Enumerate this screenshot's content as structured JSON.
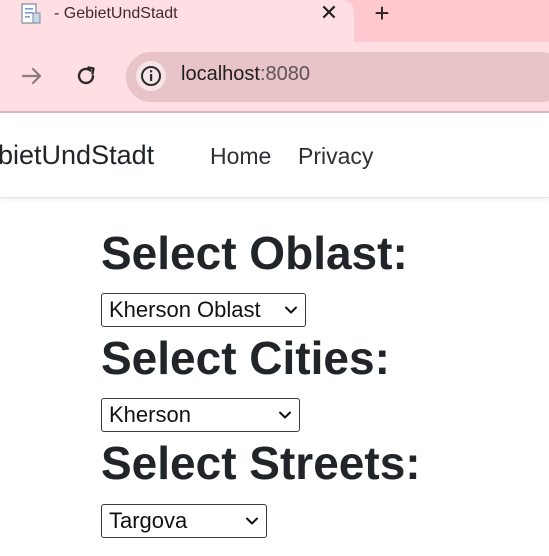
{
  "browser": {
    "tab_title": "- GebietUndStadt",
    "url_host": "localhost",
    "url_port": ":8080",
    "favicon": "page-icon",
    "close_symbol": "✕",
    "newtab_symbol": "+"
  },
  "navbar": {
    "brand": "bietUndStadt",
    "links": [
      "Home",
      "Privacy"
    ]
  },
  "form": {
    "oblast_heading": "Select Oblast:",
    "oblast_value": "Kherson Oblast",
    "cities_heading": "Select Cities:",
    "cities_value": "Kherson",
    "streets_heading": "Select Streets:",
    "streets_value": "Targova"
  },
  "colors": {
    "tabstrip": "#ffc8cf",
    "toolbar": "#ffdfe3",
    "omnibox": "#e8c3c8",
    "text": "#212529"
  }
}
